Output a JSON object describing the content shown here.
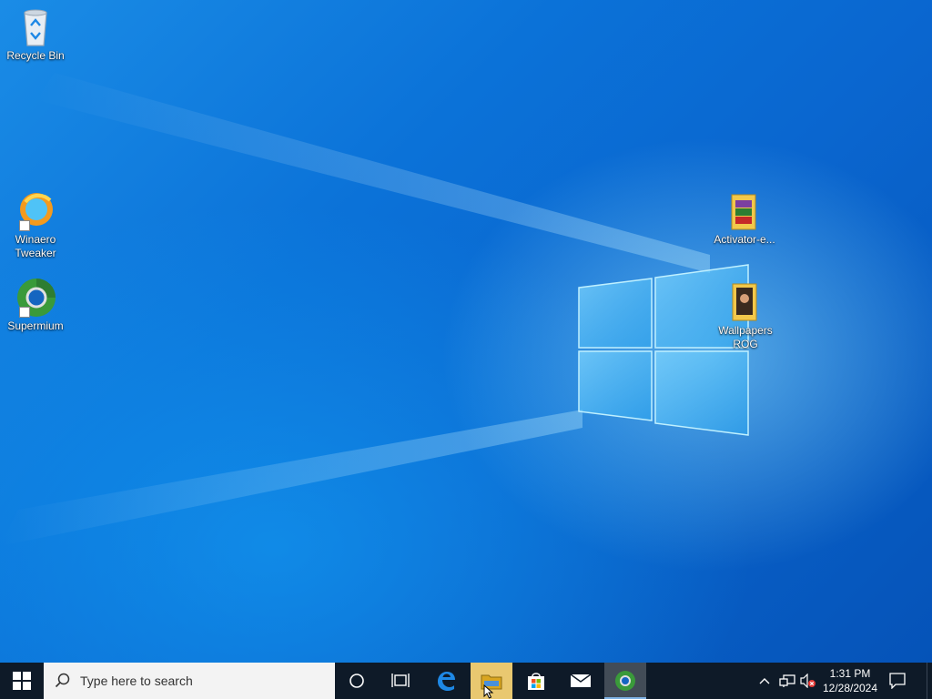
{
  "desktop": {
    "icons": [
      {
        "label": "Recycle Bin"
      },
      {
        "label": "Winaero Tweaker"
      },
      {
        "label": "Supermium"
      },
      {
        "label": "Activator-e..."
      },
      {
        "label": "Wallpapers ROG"
      }
    ]
  },
  "taskbar": {
    "search_placeholder": "Type here to search",
    "pinned": [
      "cortana-icon",
      "task-view-icon",
      "edge-icon",
      "file-explorer-icon",
      "store-icon",
      "mail-icon",
      "supermium-icon"
    ],
    "clock": {
      "time": "1:31 PM",
      "date": "12/28/2024"
    },
    "colors": {
      "taskbar_bg": "#0e1a28",
      "accent": "#0a6fd6"
    }
  }
}
